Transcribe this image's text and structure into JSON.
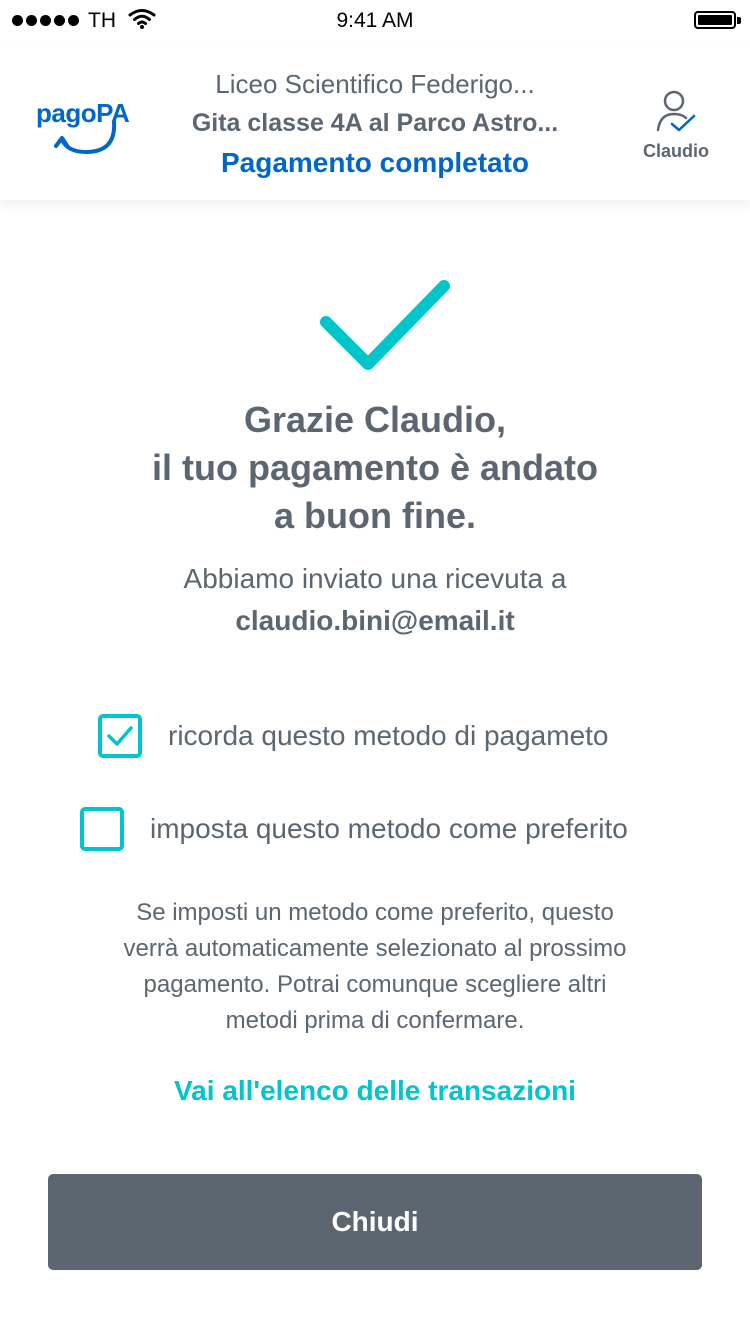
{
  "status_bar": {
    "carrier": "TH",
    "time": "9:41 AM",
    "signal_icon": "signal-dots-icon",
    "wifi_icon": "wifi-icon",
    "battery_icon": "battery-icon",
    "battery_level": 1.0
  },
  "header": {
    "logo_text": "pagoPA",
    "institution": "Liceo Scientifico Federigo...",
    "payment_subject": "Gita classe 4A al Parco Astro...",
    "status": "Pagamento completato",
    "user_name": "Claudio",
    "user_icon": "user-verified-icon"
  },
  "main": {
    "success_icon": "checkmark-icon",
    "thanks_lines": [
      "Grazie Claudio,",
      "il tuo pagamento è andato",
      "a buon fine."
    ],
    "receipt_text": "Abbiamo inviato una ricevuta a",
    "receipt_email": "claudio.bini@email.it",
    "options": [
      {
        "label": "ricorda questo metodo di pagameto",
        "checked": true
      },
      {
        "label": "imposta questo metodo come preferito",
        "checked": false
      }
    ],
    "note_lines": [
      "Se imposti un metodo come preferito, questo",
      "verrà automaticamente selezionato al prossimo",
      "pagamento. Potrai comunque  scegliere altri",
      "metodi prima di confermare."
    ],
    "transactions_link": "Vai all'elenco delle transazioni",
    "close_button": "Chiudi"
  },
  "colors": {
    "brand_blue": "#0066cc",
    "accent_teal": "#00c5ca",
    "text_gray": "#5c6670",
    "button_gray": "#5c6670"
  }
}
